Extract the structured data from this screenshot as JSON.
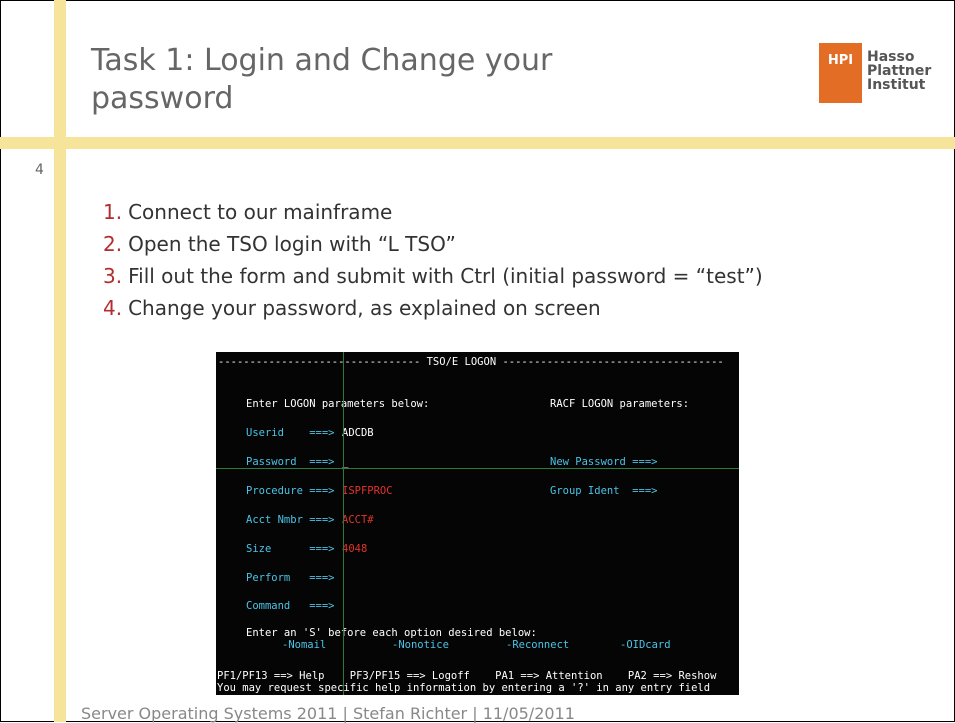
{
  "slide": {
    "title": "Task 1: Login and Change your password",
    "number": "4",
    "logo": {
      "box_text": "HPI",
      "line1": "Hasso",
      "line2": "Plattner",
      "line3": "Institut"
    },
    "steps": [
      {
        "num": "1.",
        "text": "Connect to our mainframe"
      },
      {
        "num": "2.",
        "text": "Open the TSO login with “L TSO”"
      },
      {
        "num": "3.",
        "text": "Fill out the form and submit with Ctrl (initial password = “test”)"
      },
      {
        "num": "4.",
        "text": "Change your password, as explained on screen"
      }
    ],
    "footer": "Server Operating Systems 2011 | Stefan Richter | 11/05/2011"
  },
  "terminal": {
    "header": "-------------------------------- TSO/E LOGON -----------------------------------",
    "enter_params": "Enter LOGON parameters below:",
    "racf_params": "RACF LOGON parameters:",
    "userid_label": "Userid    ===>",
    "userid_value": "ADCDB",
    "password_label": "Password  ===>",
    "password_cursor": "_",
    "new_password_label": "New Password ===>",
    "procedure_label": "Procedure ===>",
    "procedure_value": "ISPFPROC",
    "group_ident_label": "Group Ident  ===>",
    "acct_label": "Acct Nmbr ===>",
    "acct_value": "ACCT#",
    "size_label": "Size      ===>",
    "size_value": "4048",
    "perform_label": "Perform   ===>",
    "command_label": "Command   ===>",
    "options_prompt": "Enter an 'S' before each option desired below:",
    "opt_nomail": "-Nomail",
    "opt_nonotice": "-Nonotice",
    "opt_reconnect": "-Reconnect",
    "opt_oidcard": "-OIDcard",
    "pf_keys": "PF1/PF13 ==> Help    PF3/PF15 ==> Logoff    PA1 ==> Attention    PA2 ==> Reshow",
    "help_line": "You may request specific help information by entering a '?' in any entry field"
  },
  "colors": {
    "accent_bar": "#f5e49a",
    "step_number": "#b32d2d",
    "hpi_orange": "#e36d25",
    "term_cyan": "#4ac3e6",
    "term_red": "#e2332a"
  }
}
